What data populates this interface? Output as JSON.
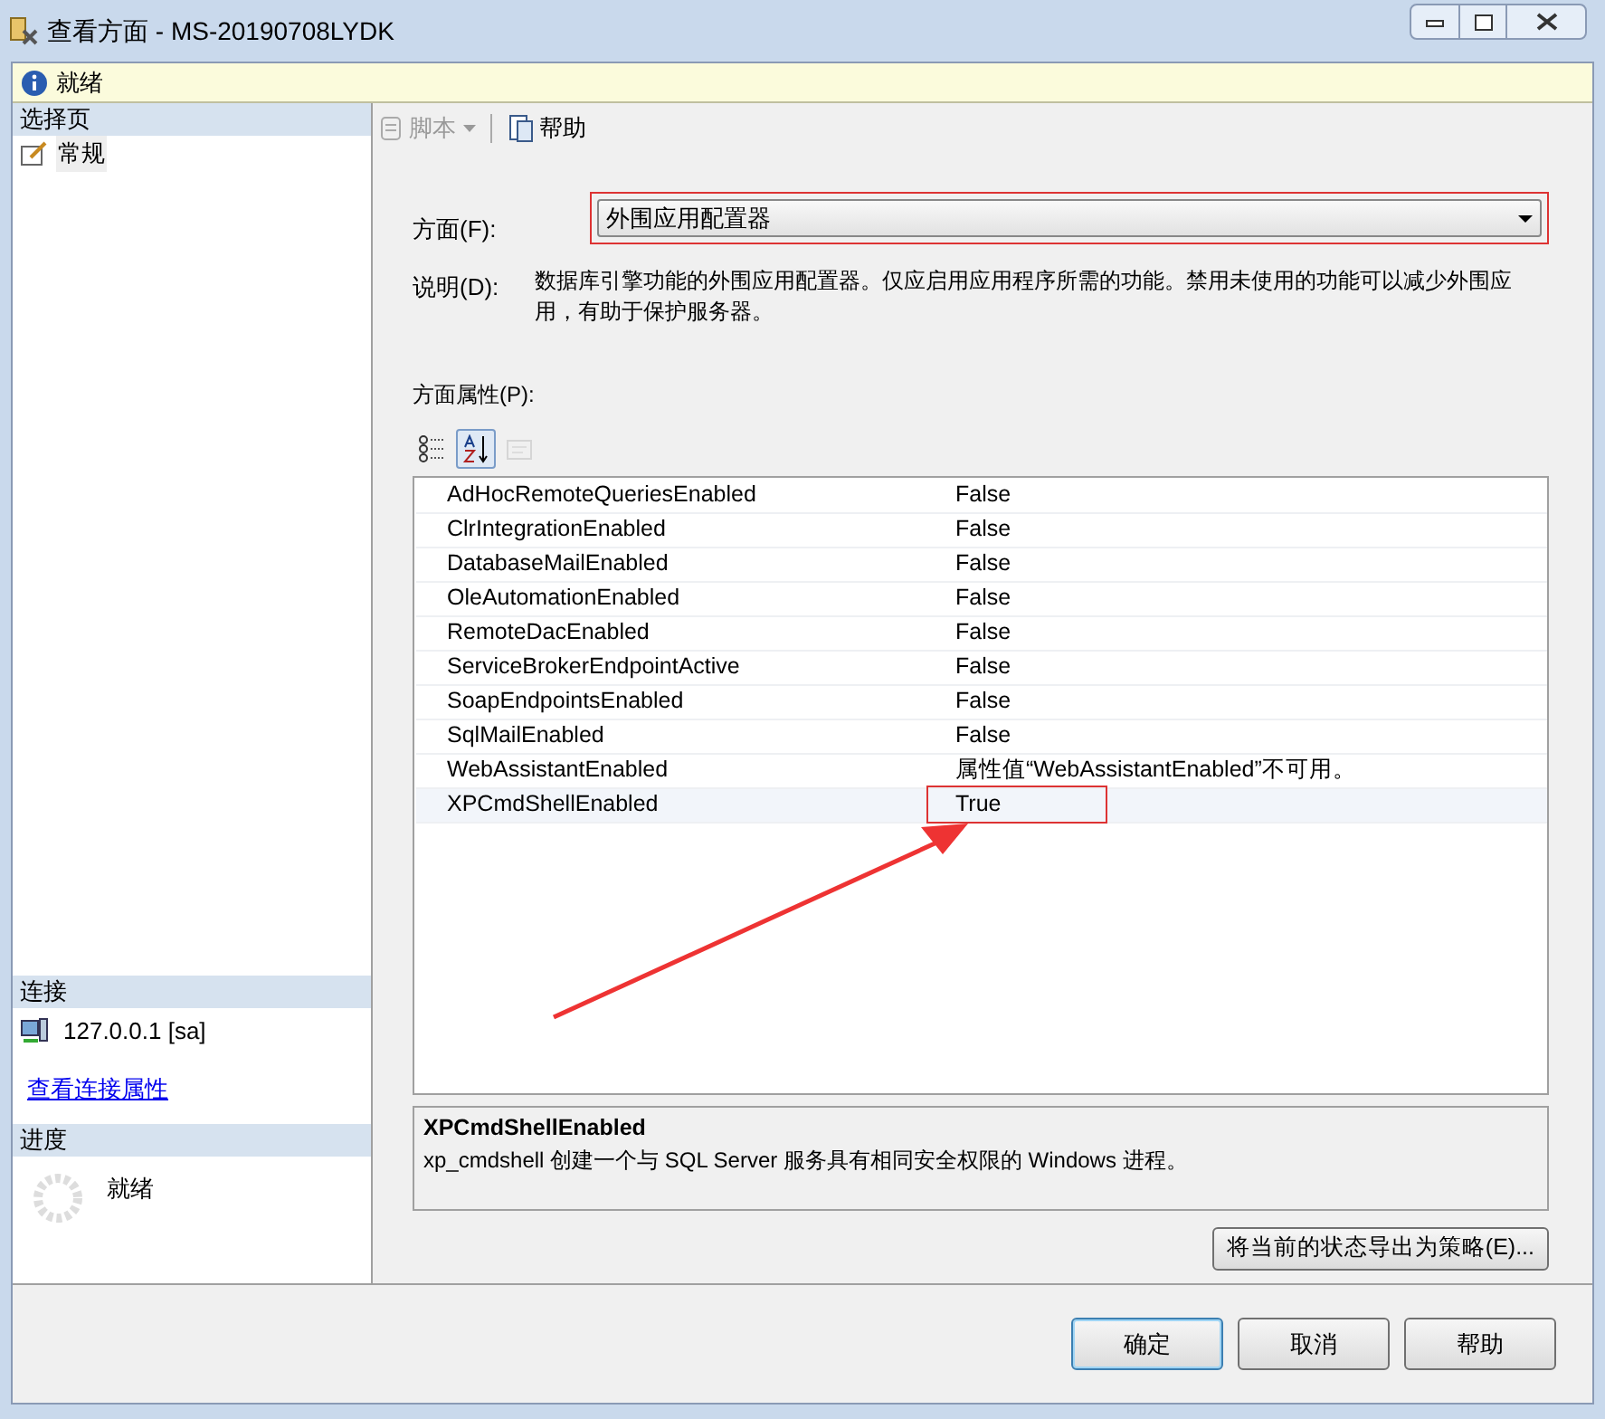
{
  "window": {
    "title": "查看方面 - MS-20190708LYDK"
  },
  "info_bar": {
    "text": "就绪"
  },
  "sidebar": {
    "header": "选择页",
    "items": [
      {
        "label": "常规",
        "selected": true
      }
    ],
    "connection_header": "连接",
    "connection": "127.0.0.1 [sa]",
    "connection_link": "查看连接属性",
    "progress_header": "进度",
    "progress_status": "就绪"
  },
  "toolbar": [
    {
      "label": "脚本",
      "disabled": true,
      "kind": "script"
    },
    {
      "label": "帮助",
      "disabled": false,
      "kind": "help"
    }
  ],
  "facet": {
    "label": "方面(F):",
    "value": "外围应用配置器",
    "highlighted": true
  },
  "description": {
    "label": "说明(D):",
    "text": "数据库引擎功能的外围应用配置器。仅应启用应用程序所需的功能。禁用未使用的功能可以减少外围应用，有助于保护服务器。"
  },
  "properties_label": "方面属性(P):",
  "property_buttons": [
    {
      "kind": "categorized",
      "selected": false,
      "disabled": false
    },
    {
      "kind": "alphabetical",
      "selected": true,
      "disabled": false
    },
    {
      "kind": "pages",
      "selected": false,
      "disabled": true
    }
  ],
  "properties": [
    {
      "name": "AdHocRemoteQueriesEnabled",
      "value": "False",
      "selected": false,
      "highlighted": false
    },
    {
      "name": "ClrIntegrationEnabled",
      "value": "False",
      "selected": false,
      "highlighted": false
    },
    {
      "name": "DatabaseMailEnabled",
      "value": "False",
      "selected": false,
      "highlighted": false
    },
    {
      "name": "OleAutomationEnabled",
      "value": "False",
      "selected": false,
      "highlighted": false
    },
    {
      "name": "RemoteDacEnabled",
      "value": "False",
      "selected": false,
      "highlighted": false
    },
    {
      "name": "ServiceBrokerEndpointActive",
      "value": "False",
      "selected": false,
      "highlighted": false
    },
    {
      "name": "SoapEndpointsEnabled",
      "value": "False",
      "selected": false,
      "highlighted": false
    },
    {
      "name": "SqlMailEnabled",
      "value": "False",
      "selected": false,
      "highlighted": false
    },
    {
      "name": "WebAssistantEnabled",
      "value": "属性值“WebAssistantEnabled”不可用。",
      "selected": false,
      "highlighted": false
    },
    {
      "name": "XPCmdShellEnabled",
      "value": "True",
      "selected": true,
      "highlighted": true
    }
  ],
  "property_help": {
    "title": "XPCmdShellEnabled",
    "text": "xp_cmdshell 创建一个与 SQL Server 服务具有相同安全权限的 Windows 进程。"
  },
  "export_button": "将当前的状态导出为策略(E)...",
  "buttons": [
    {
      "label": "确定",
      "default": true
    },
    {
      "label": "取消",
      "default": false
    },
    {
      "label": "帮助",
      "default": false
    }
  ]
}
